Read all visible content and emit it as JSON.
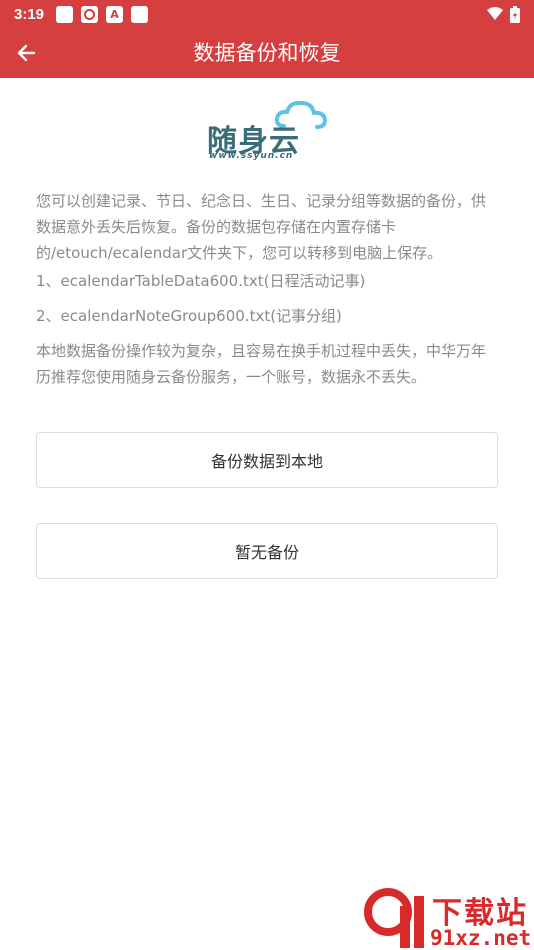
{
  "status_bar": {
    "time": "3:19",
    "icon_glyphs": [
      "",
      "",
      "A",
      ""
    ]
  },
  "app_bar": {
    "title": "数据备份和恢复"
  },
  "logo": {
    "text": "随身云",
    "url": "www.ssyun.cn"
  },
  "content": {
    "intro": "您可以创建记录、节日、纪念日、生日、记录分组等数据的备份，供数据意外丢失后恢复。备份的数据包存储在内置存储卡的/etouch/ecalendar文件夹下，您可以转移到电脑上保存。",
    "file1": "1、ecalendarTableData600.txt(日程活动记事)",
    "file2": "2、ecalendarNoteGroup600.txt(记事分组)",
    "note": "本地数据备份操作较为复杂，且容易在换手机过程中丢失，中华万年历推荐您使用随身云备份服务，一个账号，数据永不丢失。"
  },
  "buttons": {
    "backup_local": "备份数据到本地",
    "no_backup": "暂无备份"
  },
  "watermark": {
    "text": "下载站",
    "url": "91xz.net"
  },
  "colors": {
    "primary": "#d53f3f",
    "text_gray": "#8a8a8a",
    "logo_teal": "#3a6d7a"
  },
  "icons": {
    "back": "arrow-left-icon",
    "wifi": "wifi-icon",
    "battery": "battery-icon"
  }
}
